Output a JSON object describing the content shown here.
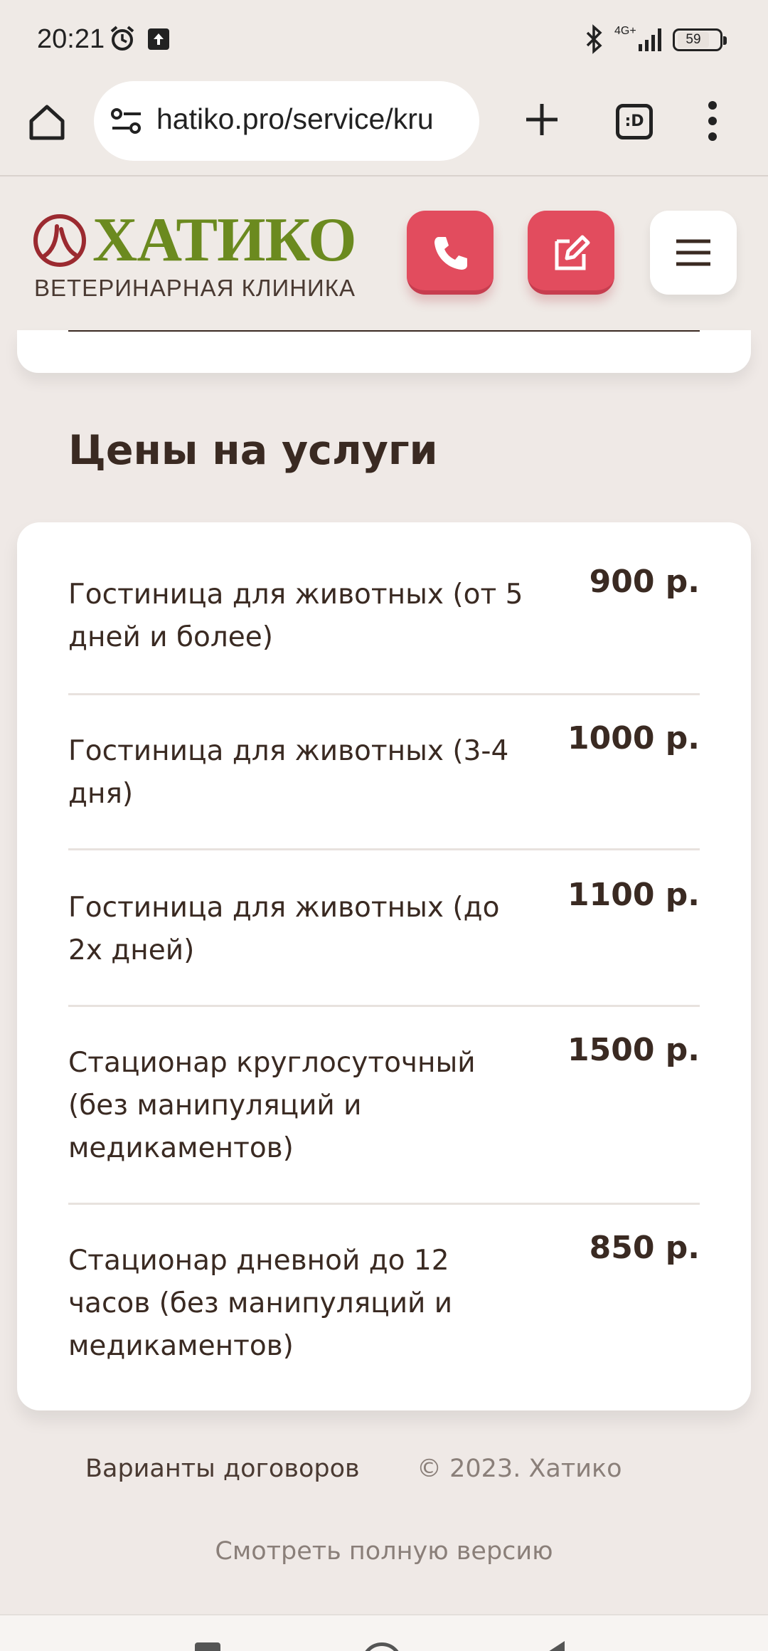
{
  "status_bar": {
    "time": "20:21",
    "network": "4G+",
    "battery": "59",
    "icons": [
      "alarm-icon",
      "upload-icon",
      "bluetooth-icon",
      "signal-icon",
      "battery-icon"
    ]
  },
  "browser": {
    "url": "hatiko.pro/service/kru",
    "tabs_label": ":D",
    "icons": [
      "home-icon",
      "site-settings-icon",
      "plus-icon",
      "tabs-icon",
      "more-icon"
    ]
  },
  "header": {
    "logo_title": "ХАТИКО",
    "logo_subtitle": "ВЕТЕРИНАРНАЯ КЛИНИКА",
    "buttons": [
      "phone-icon",
      "edit-icon",
      "menu-icon"
    ]
  },
  "prices": {
    "title": "Цены на услуги",
    "items": [
      {
        "name": "Гостиница для животных (от 5 дней и более)",
        "price": "900 р."
      },
      {
        "name": "Гостиница для животных (3-4 дня)",
        "price": "1000 р."
      },
      {
        "name": "Гостиница для животных (до 2х дней)",
        "price": "1100 р."
      },
      {
        "name": "Стационар круглосуточный (без манипуляций и медикаментов)",
        "price": "1500 р."
      },
      {
        "name": "Стационар дневной до 12 часов (без манипуляций и медикаментов)",
        "price": "850 р."
      }
    ]
  },
  "footer": {
    "contracts_link": "Варианты договоров",
    "copyright": "© 2023. Хатико",
    "full_version": "Смотреть полную версию"
  },
  "colors": {
    "accent_red": "#e24c5e",
    "logo_green": "#6b8a1f",
    "logo_red": "#9b2a30",
    "text_brown": "#3a2a22",
    "background": "#efe9e6"
  }
}
